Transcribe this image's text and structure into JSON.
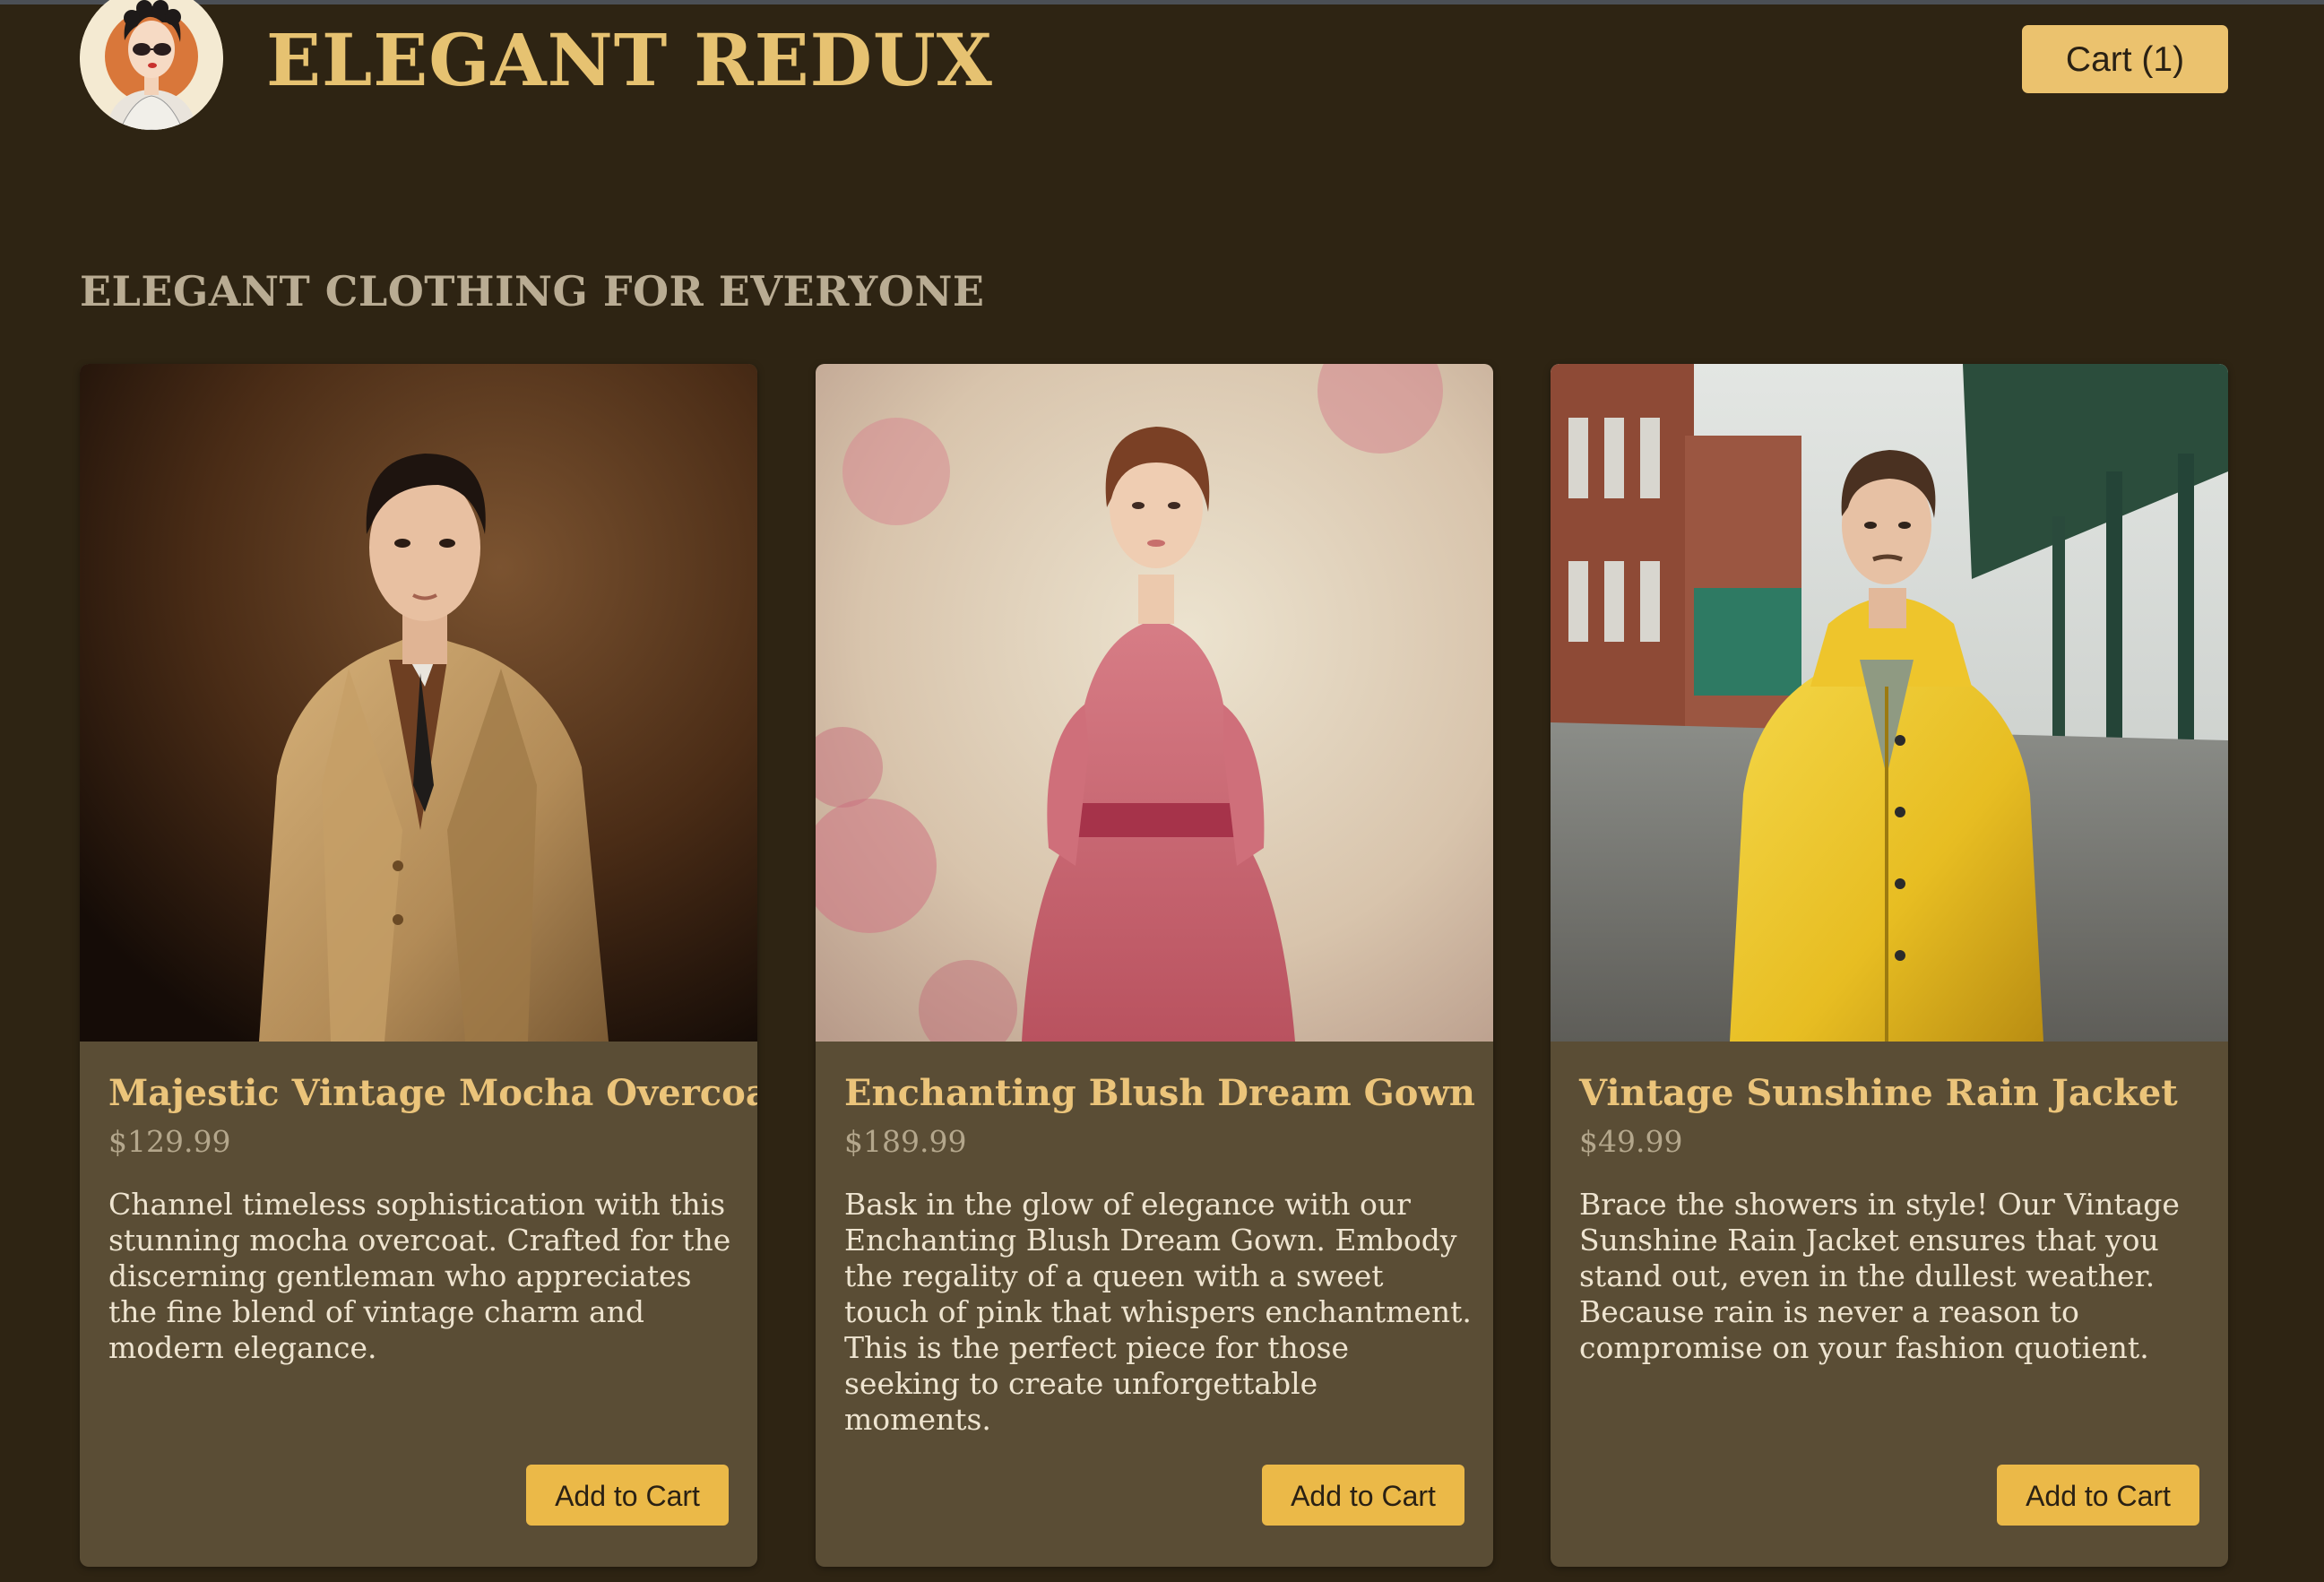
{
  "header": {
    "brand": "ELEGANT REDUX",
    "cart_label": "Cart (1)"
  },
  "section_title": "ELEGANT CLOTHING FOR EVERYONE",
  "products": [
    {
      "name": "Majestic Vintage Mocha Overcoat",
      "price": "$129.99",
      "description": "Channel timeless sophistication with this stunning mocha overcoat. Crafted for the discerning gentleman who appreciates the fine blend of vintage charm and modern elegance.",
      "button_label": "Add to Cart"
    },
    {
      "name": "Enchanting Blush Dream Gown",
      "price": "$189.99",
      "description": "Bask in the glow of elegance with our Enchanting Blush Dream Gown. Embody the regality of a queen with a sweet touch of pink that whispers enchantment. This is the perfect piece for those seeking to create unforgettable moments.",
      "button_label": "Add to Cart"
    },
    {
      "name": "Vintage Sunshine Rain Jacket",
      "price": "$49.99",
      "description": "Brace the showers in style! Our Vintage Sunshine Rain Jacket ensures that you stand out, even in the dullest weather. Because rain is never a reason to compromise on your fashion quotient.",
      "button_label": "Add to Cart"
    }
  ],
  "colors": {
    "page_background": "#2e2413",
    "card_background": "#5a4d35",
    "brand_gold": "#e6c271",
    "button_gold": "#ebb948",
    "product_name": "#ebc47a"
  },
  "icons": {
    "logo": "vintage-woman-with-sunglasses-logo"
  }
}
